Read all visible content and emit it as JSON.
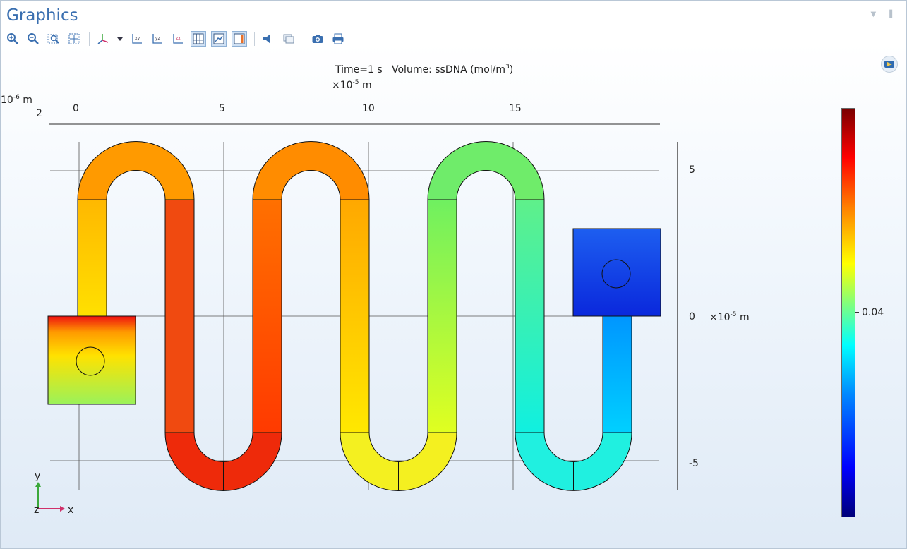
{
  "panel": {
    "title": "Graphics"
  },
  "toolbar": {
    "buttons": [
      {
        "icon": "zoom-in-icon"
      },
      {
        "icon": "zoom-out-icon"
      },
      {
        "icon": "zoom-box-icon"
      },
      {
        "icon": "zoom-extents-icon"
      },
      {
        "icon": "view-axes-icon"
      },
      {
        "icon": "view-dropdown-icon"
      },
      {
        "icon": "xy-view-icon",
        "label": "xy"
      },
      {
        "icon": "yz-view-icon",
        "label": "yz"
      },
      {
        "icon": "zx-view-icon",
        "label": "zx"
      },
      {
        "icon": "grid-toggle-icon",
        "active": true
      },
      {
        "icon": "axis-toggle-icon",
        "active": true
      },
      {
        "icon": "colorbar-toggle-icon",
        "active": true
      },
      {
        "icon": "speaker-icon"
      },
      {
        "icon": "window-icon"
      },
      {
        "icon": "camera-icon"
      },
      {
        "icon": "print-icon"
      }
    ]
  },
  "plot": {
    "title": "Time=1 s   Volume: ssDNA (mol/m",
    "title_exp": "3",
    "title_close": ")",
    "x_scale_prefix": "×10",
    "x_scale_exp": "-5",
    "x_scale_unit": " m",
    "z_unit_prefix": "10",
    "z_unit_exp": "-6",
    "z_unit_suffix": " m",
    "z_tick": "2",
    "top_ticks": [
      "0",
      "5",
      "10",
      "15"
    ],
    "right_ticks": [
      "5",
      "0",
      "-5"
    ],
    "right_scale_prefix": "×10",
    "right_scale_exp": "-5",
    "right_scale_unit": " m",
    "triad": {
      "y": "y",
      "z": "z",
      "x": "x"
    }
  },
  "colorbar": {
    "tick_label": "0.04",
    "colors": {
      "high": "#7a0000",
      "mid": "#7fff7f",
      "low": "#00007a"
    }
  }
}
